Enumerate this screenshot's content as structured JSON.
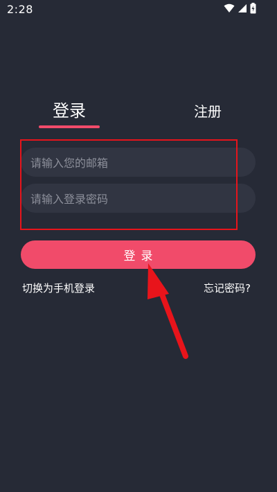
{
  "status_bar": {
    "time": "2:28",
    "icons": [
      "wifi-icon",
      "signal-icon",
      "battery-icon"
    ]
  },
  "tabs": {
    "login_label": "登录",
    "register_label": "注册",
    "active": "login"
  },
  "form": {
    "email_placeholder": "请输入您的邮箱",
    "password_placeholder": "请输入登录密码"
  },
  "login_button_label": "登录",
  "links": {
    "switch_to_phone": "切换为手机登录",
    "forgot_password": "忘记密码?"
  },
  "colors": {
    "background": "#262a36",
    "input_background": "#313542",
    "accent": "#f14b6a",
    "annotation_red": "#e8141b"
  }
}
